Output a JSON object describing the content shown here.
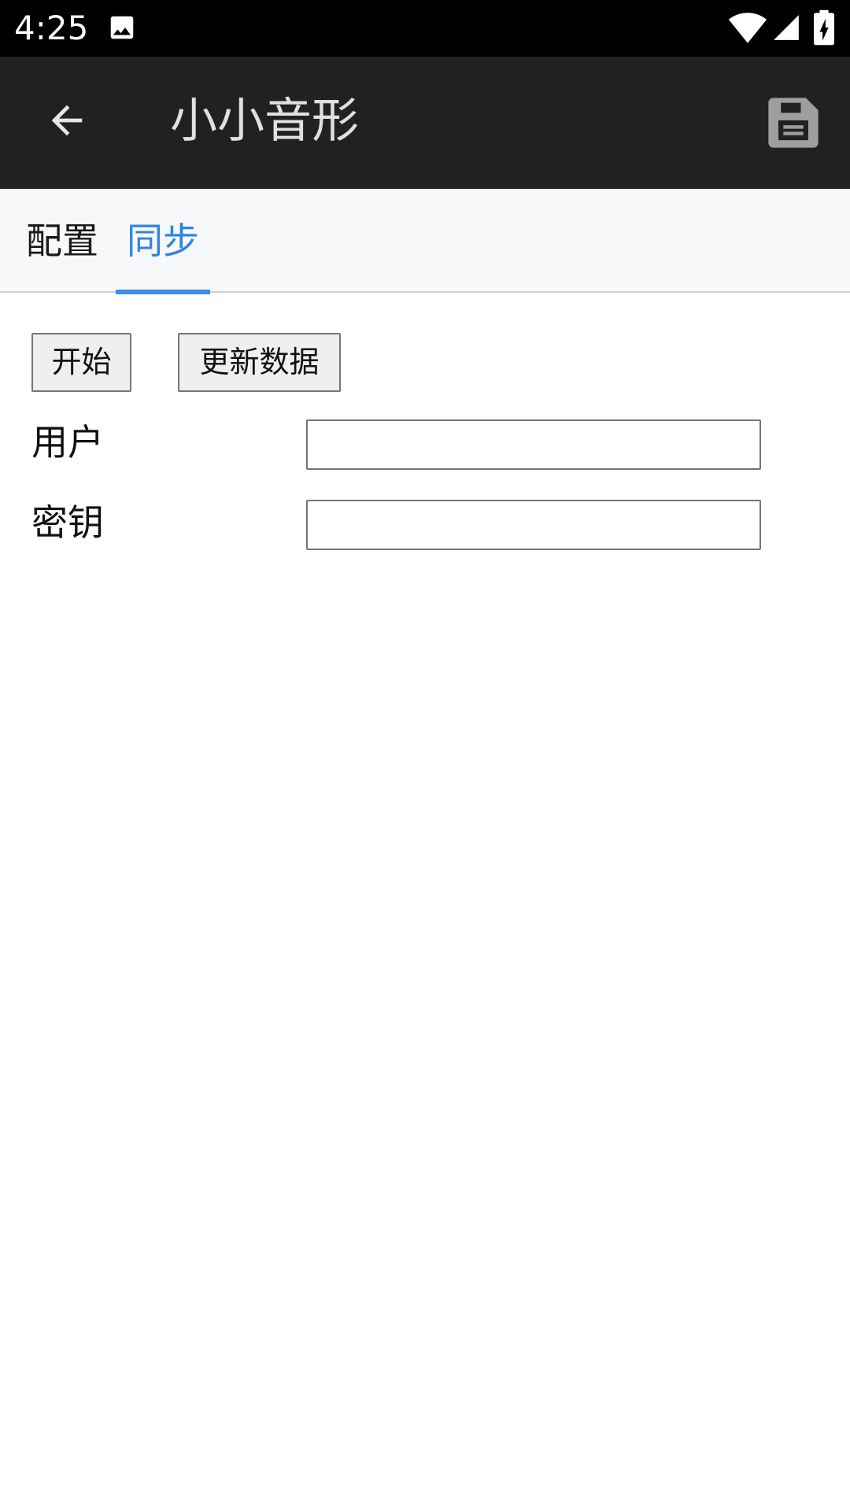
{
  "status_bar": {
    "time": "4:25",
    "icons": [
      "image-icon",
      "wifi-icon",
      "signal-icon",
      "battery-charging-icon"
    ]
  },
  "app_bar": {
    "title": "小小音形",
    "back_icon": "arrow-back-icon",
    "save_icon": "floppy-save-icon"
  },
  "tabs": [
    {
      "label": "配置",
      "selected": false
    },
    {
      "label": "同步",
      "selected": true
    }
  ],
  "sync": {
    "start_button": "开始",
    "update_button": "更新数据",
    "user_label": "用户",
    "user_value": "",
    "key_label": "密钥",
    "key_value": ""
  },
  "colors": {
    "status_bar": "#000000",
    "app_bar": "#212121",
    "tab_active": "#2f86e0",
    "tab_bar": "#f7f8fa"
  }
}
